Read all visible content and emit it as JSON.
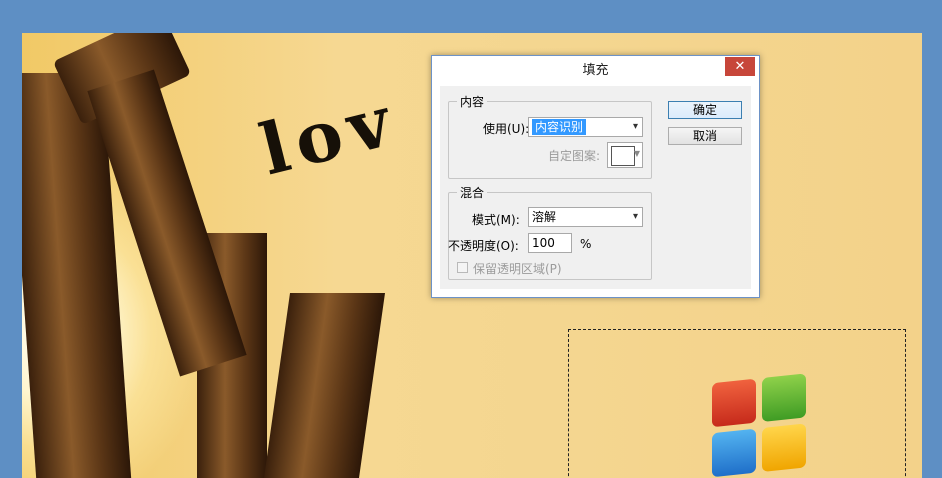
{
  "dialog": {
    "title": "填充",
    "close_glyph": "✕",
    "content_group": {
      "legend": "内容",
      "use_label": "使用(U):",
      "use_value": "内容识别",
      "custom_pattern_label": "自定图案:"
    },
    "blend_group": {
      "legend": "混合",
      "mode_label": "模式(M):",
      "mode_value": "溶解",
      "opacity_label": "不透明度(O):",
      "opacity_value": "100",
      "opacity_unit": "%",
      "preserve_transparency_label": "保留透明区域(P)"
    },
    "ok_label": "确定",
    "cancel_label": "取消"
  },
  "canvas": {
    "artwork_text": "lov"
  },
  "colors": {
    "desktop": "#5e8fc4",
    "close_button": "#c7463a",
    "selection_highlight": "#3399ff"
  }
}
